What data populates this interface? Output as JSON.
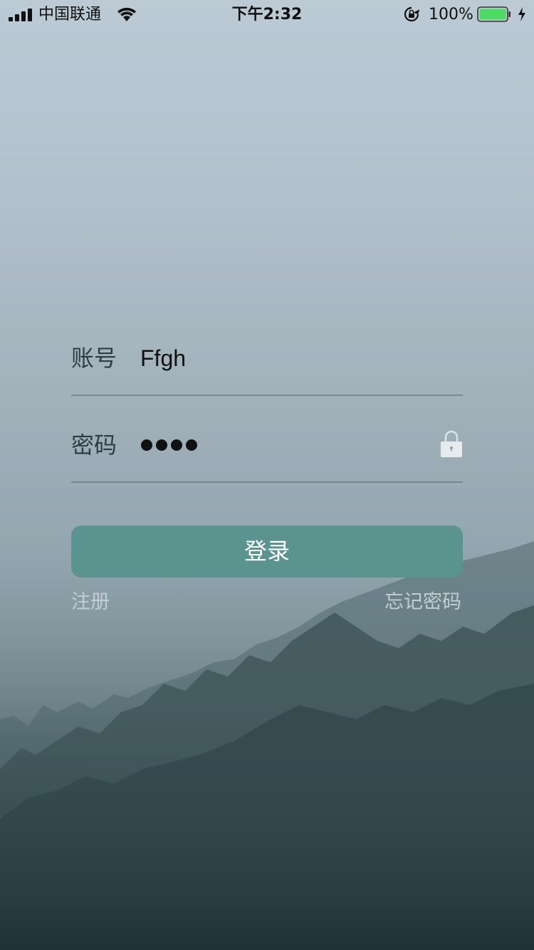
{
  "status_bar": {
    "carrier": "中国联通",
    "time": "下午2:32",
    "battery_percent": "100%",
    "battery_level": 1.0,
    "battery_color": "#4cd964",
    "icons": [
      "signal-bars-icon",
      "wifi-icon",
      "rotation-lock-icon",
      "battery-icon",
      "charging-bolt-icon"
    ]
  },
  "login_form": {
    "account": {
      "label": "账号",
      "value": "Ffgh"
    },
    "password": {
      "label": "密码",
      "masked_length": 4,
      "icon": "lock-icon"
    },
    "login_button": {
      "label": "登录",
      "color": "#5b938f"
    },
    "register_link": "注册",
    "forgot_password_link": "忘记密码"
  },
  "background": {
    "description_colors": [
      "#bccad5",
      "#8a9ea6",
      "#22383d"
    ]
  }
}
